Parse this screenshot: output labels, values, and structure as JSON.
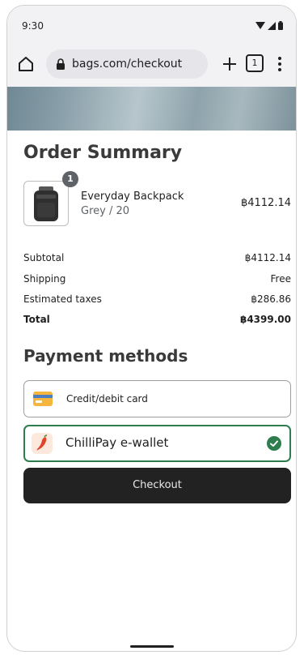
{
  "status_bar": {
    "time": "9:30",
    "icons": [
      "wifi-icon",
      "signal-icon",
      "battery-icon"
    ]
  },
  "browser": {
    "url": "bags.com/checkout",
    "tab_count": "1",
    "icons": [
      "home-icon",
      "lock-icon",
      "plus-icon",
      "tabs-icon",
      "kebab-menu-icon"
    ]
  },
  "order": {
    "title": "Order Summary",
    "item": {
      "quantity": "1",
      "name": "Everyday Backpack",
      "variant": "Grey / 20",
      "price": "฿4112.14"
    },
    "summary": [
      {
        "label": "Subtotal",
        "value": "฿4112.14"
      },
      {
        "label": "Shipping",
        "value": "Free"
      },
      {
        "label": "Estimated taxes",
        "value": "฿286.86"
      },
      {
        "label": "Total",
        "value": "฿4399.00"
      }
    ]
  },
  "payment": {
    "title": "Payment methods",
    "options": [
      {
        "label": "Credit/debit card",
        "selected": false,
        "icon": "credit-card-icon"
      },
      {
        "label": "ChilliPay e-wallet",
        "selected": true,
        "icon": "chilli-pepper-icon"
      }
    ],
    "checkout_label": "Checkout"
  },
  "colors": {
    "selected_border": "#2e7d4f",
    "checkout_button": "#222222"
  }
}
